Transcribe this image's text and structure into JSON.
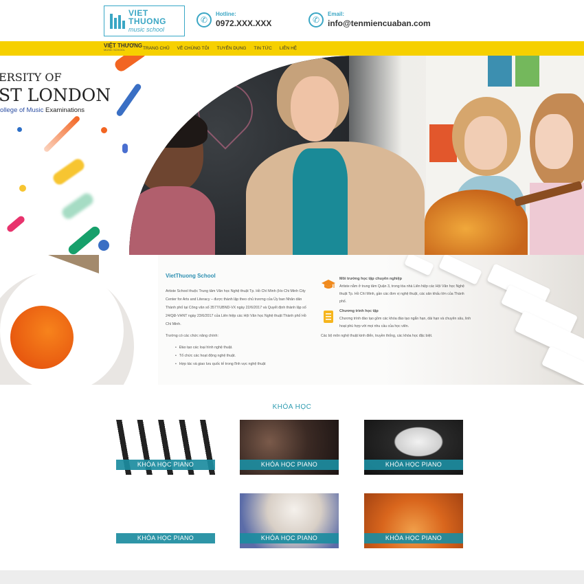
{
  "header": {
    "logo_line1": "VIET THUONG",
    "logo_line2": "music school",
    "hotline_label": "Hotline:",
    "hotline_value": "0972.XXX.XXX",
    "email_label": "Email:",
    "email_value": "info@tenmiencuaban.com",
    "phone_icon": "phone-icon",
    "email_icon": "phone-icon"
  },
  "nav": {
    "logo_text": "VIỆT THƯƠNG",
    "logo_sub": "MUSIC SCHOOL",
    "items": [
      "TRANG CHỦ",
      "VỀ CHÚNG TÔI",
      "TUYỂN DỤNG",
      "TIN TỨC",
      "LIÊN HỆ"
    ],
    "color": "#f6d000"
  },
  "banner": {
    "line1": "ERSITY OF",
    "line2": "ST LONDON",
    "line3_prefix": "ollege of Music ",
    "line3_suffix": "Examinations"
  },
  "about": {
    "title": "VietThuong School",
    "intro": "Artiste School thuộc Trung tâm Văn học Nghệ thuật Tp. Hồ Chí Minh (Ho Chi Minh City Center for Arts and Literacy – được thành lập theo chủ trương của Ủy ban Nhân dân Thành phố tại Công văn số 3577/UBND-VX ngày 22/6/2017 và Quyết định thành lập số 24/QĐ-VHNT ngày 23/6/2017 của Liên hiệp các Hội Văn học Nghệ thuật Thành phố Hồ Chí Minh.",
    "functions_title": "Trường có các chức năng chính:",
    "functions": [
      "Đào tạo các loại hình nghệ thuật.",
      "Tổ chức các hoạt động nghệ thuật.",
      "Hợp tác và giao lưu quốc tế trong lĩnh vực nghệ thuật"
    ],
    "feature1_title": "Môi trường học tập chuyên nghiệp",
    "feature1_desc": "Artiste nằm ở trung tâm Quận 3, trong tòa nhà Liên hiệp các Hội Văn học Nghệ thuật Tp. Hồ Chí Minh, gần các đơn vị nghệ thuật, các sân khấu lớn của Thành phố.",
    "feature2_title": "Chương trình học tập",
    "feature2_desc": "Chương trình đào tạo gồm các khóa đào tạo ngắn hạn, dài hạn và chuyên sâu, linh hoạt phù hợp với mọi nhu cầu của học viên.",
    "feature2_extra": "Các bộ môn nghệ thuật kinh điển, truyền thống, các khóa học đặc biệt."
  },
  "courses": {
    "title": "KHÓA HỌC",
    "items": [
      {
        "label": "KHÓA HỌC PIANO"
      },
      {
        "label": "KHÓA HỌC PIANO"
      },
      {
        "label": "KHÓA HỌC PIANO"
      },
      {
        "label": "KHÓA HỌC PIANO"
      },
      {
        "label": "KHÓA HỌC PIANO"
      },
      {
        "label": "KHÓA HỌC PIANO"
      }
    ]
  }
}
